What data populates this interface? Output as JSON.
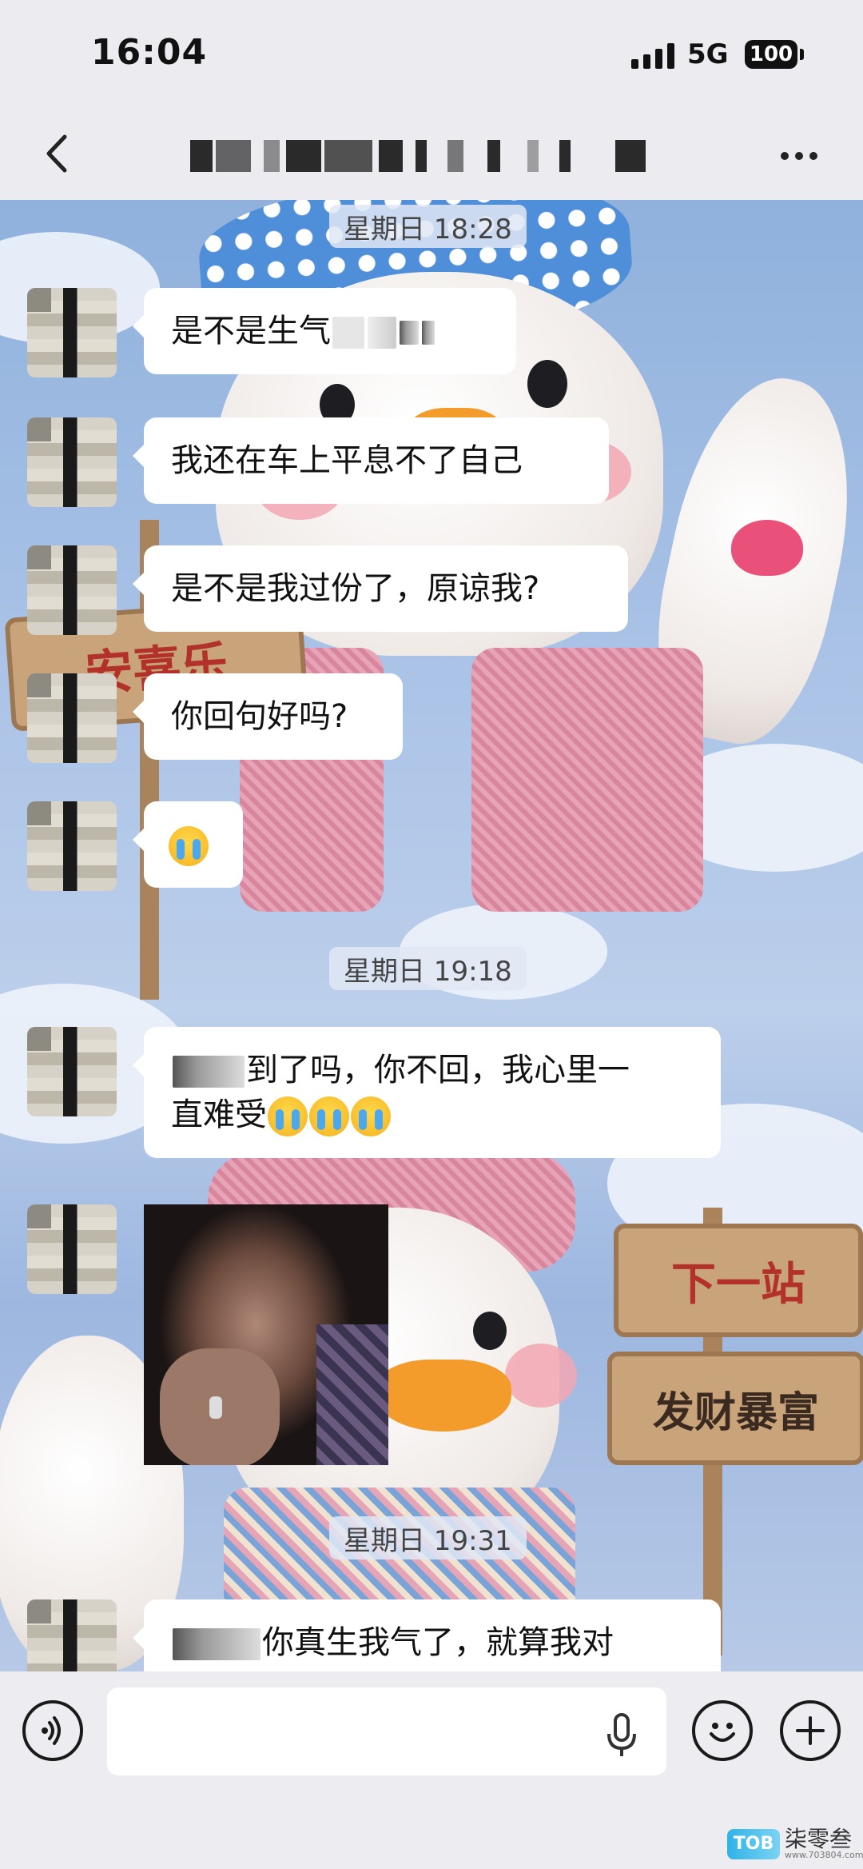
{
  "status_bar": {
    "time": "16:04",
    "network": "5G",
    "battery": "100"
  },
  "nav": {
    "back_icon": "chevron-left-icon",
    "more_icon": "more-dots-icon"
  },
  "chat": {
    "stamps": [
      "星期日 18:28",
      "星期日 19:18",
      "星期日 19:31"
    ],
    "messages": [
      {
        "type": "text",
        "text_visible": "是不是生气",
        "redacted_tail": true
      },
      {
        "type": "text",
        "text": "我还在车上平息不了自己"
      },
      {
        "type": "text",
        "text": "是不是我过份了，原谅我?"
      },
      {
        "type": "text",
        "text": "你回句好吗?"
      },
      {
        "type": "emoji",
        "emoji": "loudly-crying-face"
      },
      {
        "type": "text",
        "line1": "到了吗，你不回，我心里一",
        "line2": "直难受"
      },
      {
        "type": "image",
        "description_icon": "photo-thumbnail"
      },
      {
        "type": "text",
        "text_partial": "你真生我气了，就算我对"
      }
    ]
  },
  "background": {
    "signs": [
      "下一站",
      "发财暴富",
      "安喜乐"
    ]
  },
  "input_bar": {
    "placeholder": "",
    "voice_icon": "voice-icon",
    "mic_icon": "mic-icon",
    "emoji_icon": "emoji-icon",
    "plus_icon": "plus-icon"
  },
  "watermark": {
    "logo": "TOB",
    "name": "柒零叁",
    "url": "www.703804.com"
  },
  "colors": {
    "bubble": "#ffffff",
    "bar": "#ededf1",
    "sky": "#a9c2e6"
  }
}
